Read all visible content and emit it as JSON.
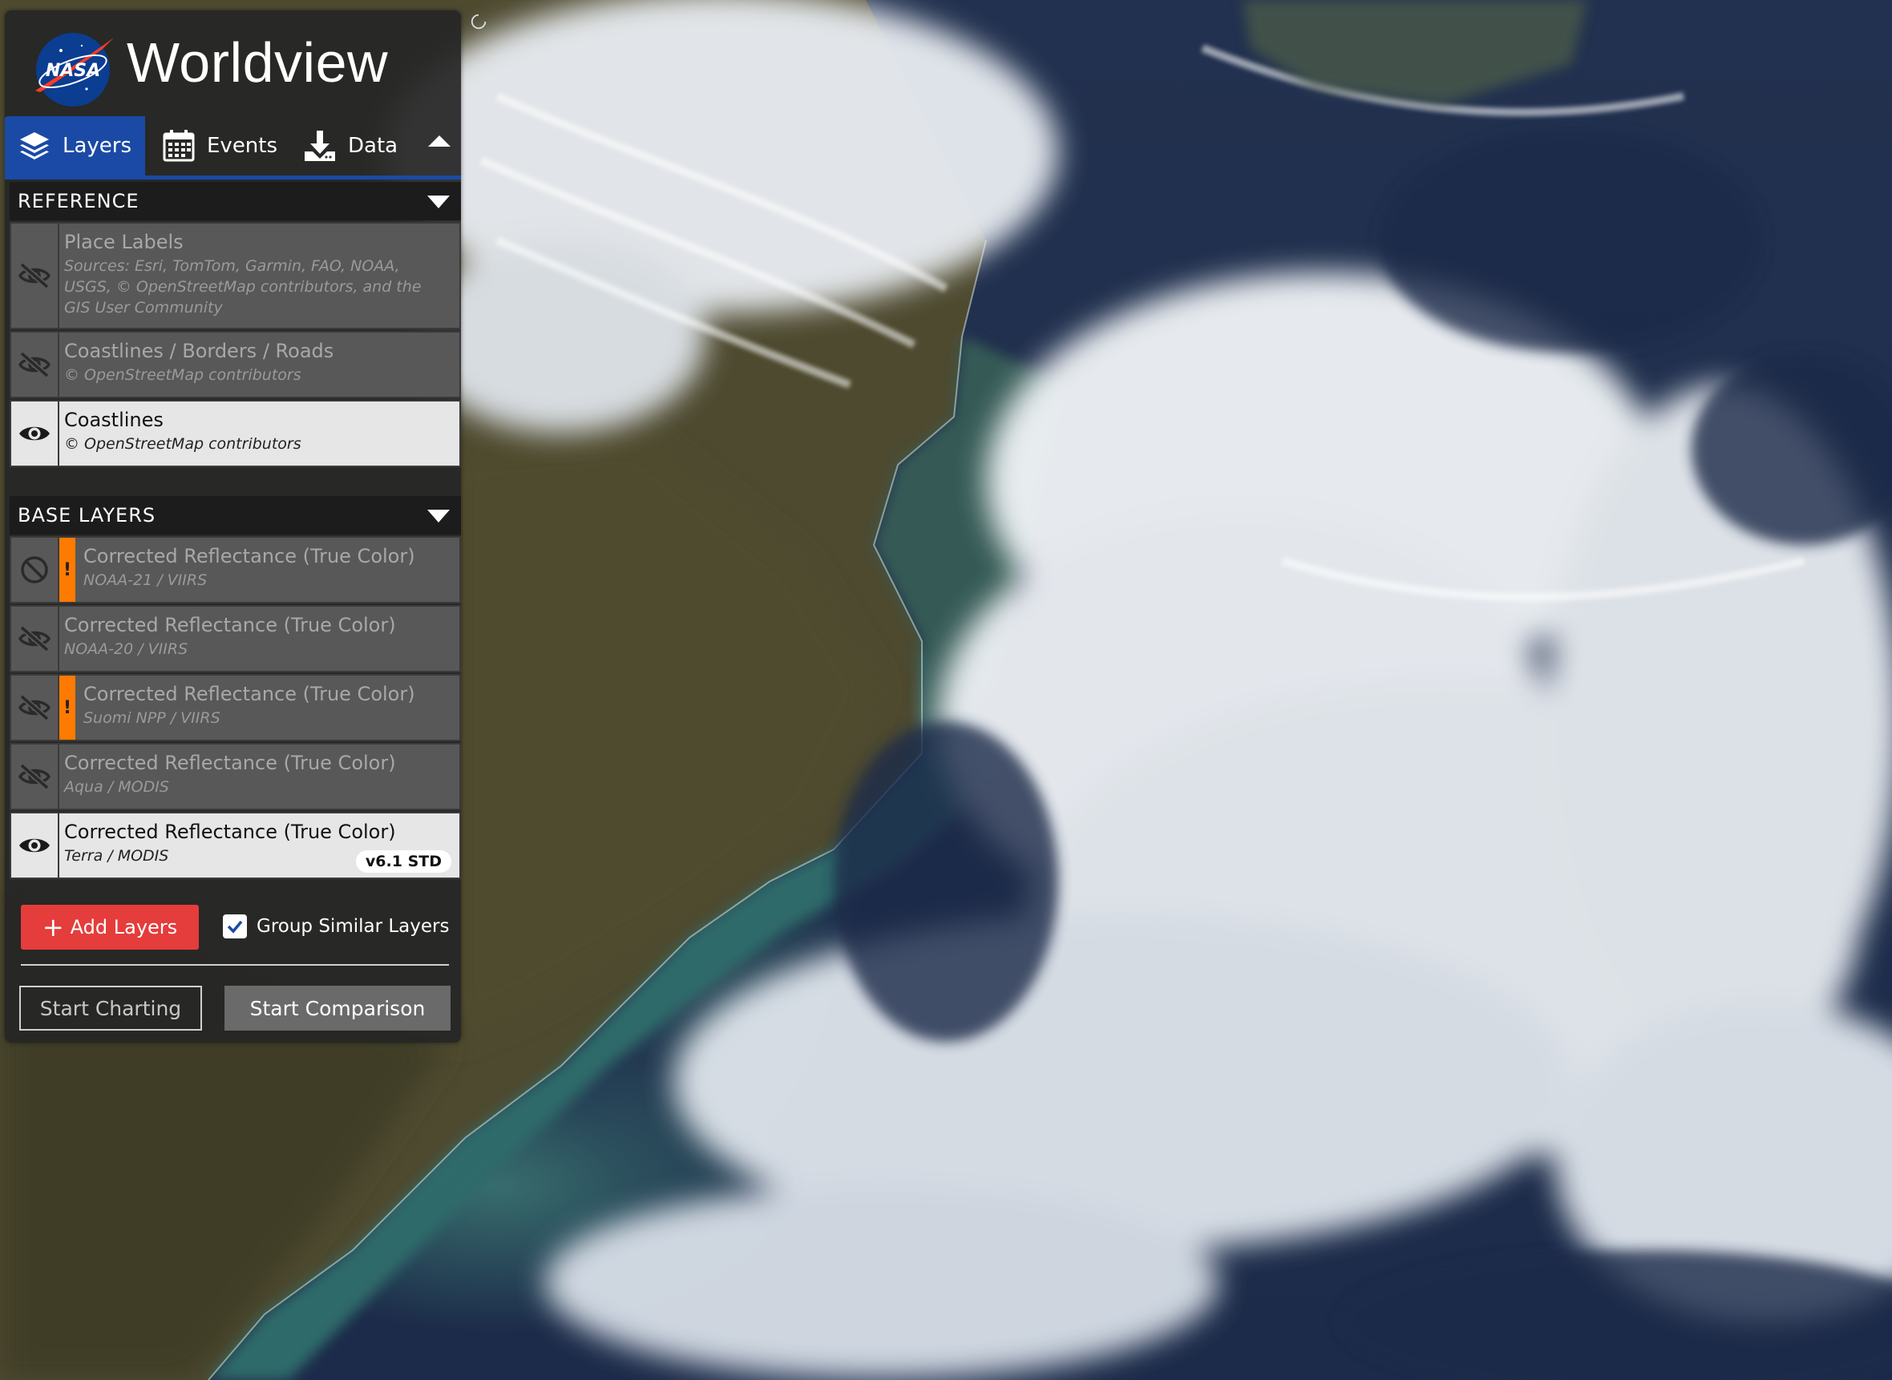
{
  "app": {
    "title": "Worldview",
    "logo_text": "NASA"
  },
  "tabs": [
    {
      "label": "Layers",
      "icon": "layers-icon",
      "active": true
    },
    {
      "label": "Events",
      "icon": "calendar-icon",
      "active": false
    },
    {
      "label": "Data",
      "icon": "download-icon",
      "active": false
    }
  ],
  "groups": {
    "reference": {
      "label": "REFERENCE",
      "layers": [
        {
          "title": "Place Labels",
          "subtitle": "Sources: Esri, TomTom, Garmin, FAO, NOAA, USGS, © OpenStreetMap contributors, and the GIS User Community",
          "visible": false,
          "icon": "eye-slash-icon"
        },
        {
          "title": "Coastlines / Borders / Roads",
          "subtitle": "© OpenStreetMap contributors",
          "visible": false,
          "icon": "eye-slash-icon"
        },
        {
          "title": "Coastlines",
          "subtitle": "© OpenStreetMap contributors",
          "visible": true,
          "icon": "eye-icon"
        }
      ]
    },
    "base": {
      "label": "BASE LAYERS",
      "layers": [
        {
          "title": "Corrected Reflectance (True Color)",
          "subtitle": "NOAA-21 / VIIRS",
          "visible": false,
          "icon": "ban-icon",
          "warning": "!"
        },
        {
          "title": "Corrected Reflectance (True Color)",
          "subtitle": "NOAA-20 / VIIRS",
          "visible": false,
          "icon": "eye-slash-icon"
        },
        {
          "title": "Corrected Reflectance (True Color)",
          "subtitle": "Suomi NPP / VIIRS",
          "visible": false,
          "icon": "eye-slash-icon",
          "warning": "!"
        },
        {
          "title": "Corrected Reflectance (True Color)",
          "subtitle": "Aqua / MODIS",
          "visible": false,
          "icon": "eye-slash-icon"
        },
        {
          "title": "Corrected Reflectance (True Color)",
          "subtitle": "Terra / MODIS",
          "visible": true,
          "icon": "eye-icon",
          "badge": "v6.1 STD"
        }
      ]
    }
  },
  "footer": {
    "add_layers": "Add Layers",
    "group_similar": "Group Similar Layers",
    "group_similar_checked": true,
    "start_charting": "Start Charting",
    "start_comparison": "Start Comparison"
  },
  "colors": {
    "active_tab": "#1b4aa6",
    "add_button": "#e53c3c",
    "warning": "#ff7a00",
    "checkbox": "#1b4aa6"
  }
}
